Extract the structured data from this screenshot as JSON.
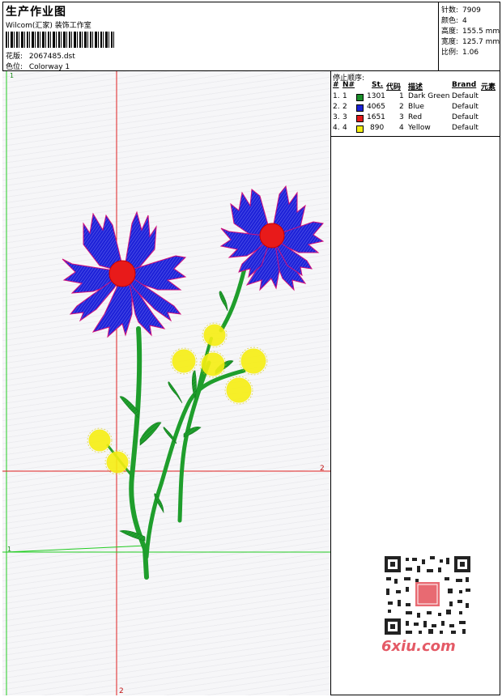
{
  "header": {
    "title": "生产作业图",
    "studio": "Wilcom(汇家) 装饰工作室",
    "design_label": "花版:",
    "design_value": "2067485.dst",
    "colorway_label": "色位:",
    "colorway_value": "Colorway 1"
  },
  "stats": [
    {
      "label": "针数:",
      "value": "7909"
    },
    {
      "label": "颜色:",
      "value": "4"
    },
    {
      "label": "高度:",
      "value": "155.5 mm"
    },
    {
      "label": "宽度:",
      "value": "125.7 mm"
    },
    {
      "label": "比例:",
      "value": "1.06"
    }
  ],
  "stops": {
    "title": "停止顺序:",
    "columns": [
      "#",
      "N#",
      "St.",
      "代码",
      "描述",
      "Brand",
      "元素"
    ],
    "rows": [
      {
        "num": "1.",
        "n": "1",
        "color": "#1a8f2a",
        "st": "1301",
        "code": "1",
        "desc": "Dark Green",
        "brand": "Default"
      },
      {
        "num": "2.",
        "n": "2",
        "color": "#1a22d6",
        "st": "4065",
        "code": "2",
        "desc": "Blue",
        "brand": "Default"
      },
      {
        "num": "3.",
        "n": "3",
        "color": "#e31a1a",
        "st": "1651",
        "code": "3",
        "desc": "Red",
        "brand": "Default"
      },
      {
        "num": "4.",
        "n": "4",
        "color": "#f4ee10",
        "st": "890",
        "code": "4",
        "desc": "Yellow",
        "brand": "Default"
      }
    ]
  },
  "canvas": {
    "marker_1": "1",
    "marker_2": "2"
  },
  "watermark": {
    "text": "6xiu.com"
  }
}
